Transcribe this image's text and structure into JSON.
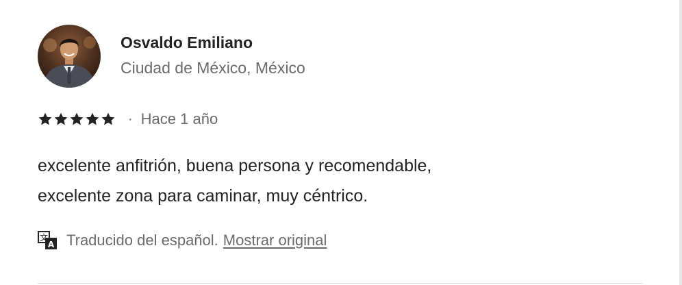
{
  "reviewer": {
    "name": "Osvaldo Emiliano",
    "location": "Ciudad de México, México"
  },
  "rating": {
    "stars": 5,
    "max_stars": 5,
    "separator": "·",
    "date": "Hace 1 año"
  },
  "review": {
    "text_line1": "excelente anfitrión, buena persona y recomendable,",
    "text_line2": "excelente zona para caminar, muy céntrico."
  },
  "translation": {
    "icon": "translate-icon",
    "note": "Traducido del español.",
    "link": "Mostrar original"
  },
  "colors": {
    "text_primary": "#222222",
    "text_secondary": "#6a6a6a",
    "divider": "#dddddd"
  }
}
